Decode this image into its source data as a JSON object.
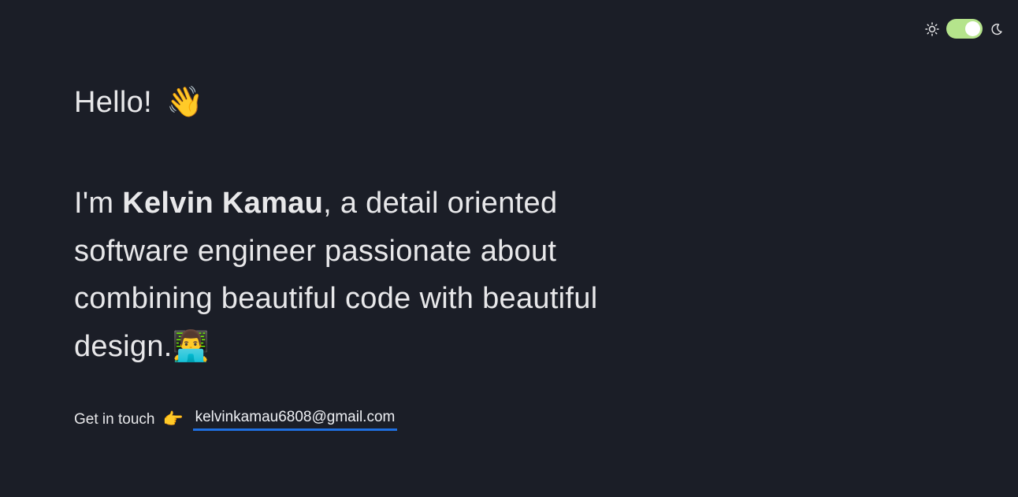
{
  "colors": {
    "background": "#1b1e27",
    "text": "#e8e8ea",
    "toggle_track": "#b5e48c",
    "link_underline": "#1f6fe0"
  },
  "theme_toggle": {
    "light_icon": "sun-icon",
    "dark_icon": "moon-icon",
    "state": "on"
  },
  "hero": {
    "greeting": "Hello!",
    "greeting_emoji": "👋",
    "intro_prefix": "I'm ",
    "name": "Kelvin Kamau",
    "intro_suffix": ", a detail oriented software engineer passionate about combining beautiful code with beautiful design.",
    "intro_emoji": "👨‍💻"
  },
  "contact": {
    "label": "Get in touch",
    "pointer_emoji": "👉",
    "email": "kelvinkamau6808@gmail.com"
  }
}
